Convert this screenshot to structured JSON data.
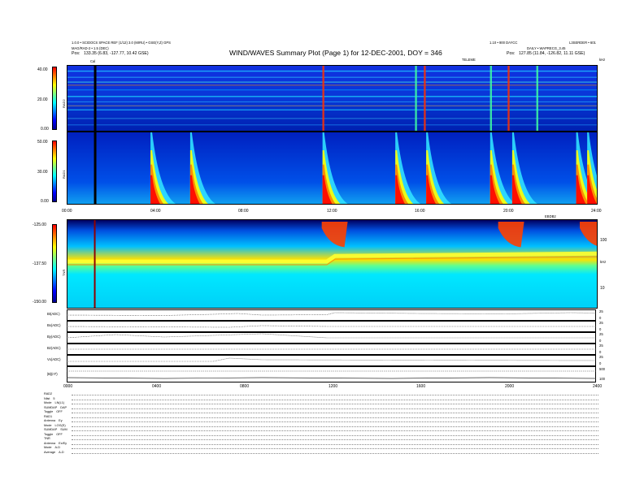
{
  "header": {
    "title": "WIND/WAVES Summary Plot (Page 1) for 12-DEC-2001, DOY = 346",
    "left_line1": "1.0.0 • SCIDOCS SPACE REF (1/12) 3.0 (MIRU) • GSE(Y,Z) GPS",
    "left_line2": "MAG/RAD-2 • 1.5 (DEC)",
    "left_pos_label": "Pos:",
    "left_pos_value": "133.35 (6.83, -127.77, 10.42 GSE)",
    "right_line1": "1.10 • 900 DAYCC",
    "right_line2": "DAILY • WAPRECG_3.45",
    "right_corner": "L3SERDER • 601",
    "right_pos_label": "Pos:",
    "right_pos_value": "127.85 (11.84, -126.82, 11.11 GSE)",
    "marker_cal": "Cal",
    "marker_center": "TELEME",
    "marker_right": "kHz"
  },
  "panels": {
    "rad2": {
      "name": "RAD2",
      "ticks": [
        "40.00",
        "20.00",
        "0.00"
      ]
    },
    "rad1": {
      "name": "RAD1",
      "ticks": [
        "50.00",
        "30.00",
        "0.00"
      ]
    },
    "tnr": {
      "name": "TNR",
      "ticks": [
        "-125.00",
        "-137.50",
        "-150.00"
      ],
      "right_ticks": [
        "100",
        "10"
      ],
      "right_unit": "kHz"
    },
    "time_ticks": [
      "00:00",
      "04:00",
      "08:00",
      "12:00",
      "16:00",
      "20:00",
      "24:00"
    ],
    "bottom_time_ticks": [
      "0000",
      "0400",
      "0800",
      "1200",
      "1600",
      "2000",
      "2400"
    ],
    "right_corner_small": "EBDB2",
    "strips": [
      {
        "label": "Bt(ADC)",
        "right": [
          "25",
          "0"
        ]
      },
      {
        "label": "Bx(ADC)",
        "right": [
          "25",
          "0"
        ]
      },
      {
        "label": "By(ADC)",
        "right": [
          "25",
          "0"
        ]
      },
      {
        "label": "Bz(ADC)",
        "right": [
          "25",
          "0"
        ]
      },
      {
        "label": "Vx(ADC)",
        "right": [
          "25",
          "0"
        ]
      },
      {
        "label": "|B|(nT)",
        "right": [
          "500",
          "100"
        ]
      }
    ]
  },
  "params": [
    {
      "label": "RAD2",
      "value": ""
    },
    {
      "label": "Nlist",
      "value": "5"
    },
    {
      "label": "Mode",
      "value": "LN(L1)"
    },
    {
      "label": "SUMDAP",
      "value": "DAP"
    },
    {
      "label": "Toggle",
      "value": "OFF"
    },
    {
      "label": "RAD1",
      "value": ""
    },
    {
      "label": "Antenna",
      "value": "Ey"
    },
    {
      "label": "Mode",
      "value": "LOG(S)"
    },
    {
      "label": "SUMDAP",
      "value": "SUM"
    },
    {
      "label": "Toggle",
      "value": "OFF"
    },
    {
      "label": "TNR",
      "value": ""
    },
    {
      "label": "Antenna",
      "value": "Ex/Ey"
    },
    {
      "label": "Mode",
      "value": "A-D"
    },
    {
      "label": "Average",
      "value": "A-D"
    }
  ],
  "colors": {
    "low": "#0000c8",
    "mid": "#00e0ff",
    "high": "#ff0000",
    "bright": "#ffff00"
  },
  "chart_data": {
    "type": "heatmap",
    "title": "WIND/WAVES Summary Plot (Page 1) for 12-DEC-2001, DOY = 346",
    "x": {
      "unit": "UT hours",
      "range": [
        0,
        24
      ]
    },
    "panels": [
      {
        "name": "RAD2",
        "color_range": [
          0,
          40
        ],
        "bursts_hours": [
          11.6,
          15.8,
          16.2,
          19.2,
          20.0,
          21.3
        ]
      },
      {
        "name": "RAD1",
        "color_range": [
          0,
          50
        ],
        "bursts_hours": [
          3.8,
          5.6,
          11.6,
          14.9,
          16.3,
          19.2,
          20.2,
          23.1,
          23.6
        ]
      },
      {
        "name": "TNR",
        "color_range": [
          -150,
          -125
        ],
        "bursts_hours": [
          11.6,
          19.6,
          23.3
        ]
      }
    ]
  }
}
